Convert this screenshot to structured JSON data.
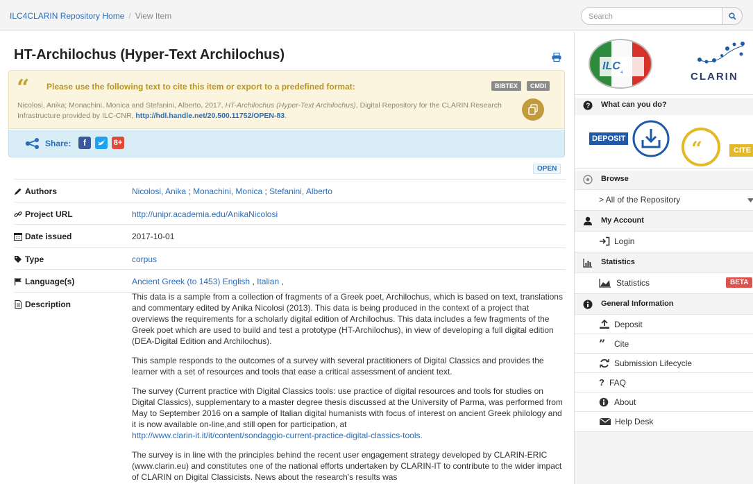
{
  "breadcrumb": {
    "home": "ILC4CLARIN Repository Home",
    "separator": "/",
    "current": "View Item"
  },
  "search": {
    "placeholder": "Search"
  },
  "item": {
    "title": "HT-Archilochus (Hyper-Text Archilochus)",
    "cite_prompt": "Please use the following text to cite this item or export to a predefined format:",
    "export_buttons": [
      "BIBTEX",
      "CMDI"
    ],
    "citation_pre": "Nicolosi, Anika; Monachini, Monica and Stefanini, Alberto, 2017, ",
    "citation_title": "HT-Archilochus (Hyper-Text Archilochus)",
    "citation_post": ", Digital Repository for the CLARIN Research Infrastructure provided by ILC-CNR, ",
    "citation_link": "http://hdl.handle.net/20.500.11752/OPEN-83",
    "citation_end": ".",
    "share_label": "Share:",
    "license_badge": "OPEN"
  },
  "metadata": {
    "authors_label": "Authors",
    "authors": [
      "Nicolosi, Anika",
      "Monachini, Monica",
      "Stefanini, Alberto"
    ],
    "project_url_label": "Project URL",
    "project_url": "http://unipr.academia.edu/AnikaNicolosi",
    "date_label": "Date issued",
    "date": "2017-10-01",
    "type_label": "Type",
    "type": "corpus",
    "language_label": "Language(s)",
    "languages": [
      "Ancient Greek (to 1453)",
      "English",
      "Italian"
    ],
    "description_label": "Description",
    "description": [
      "This data is a sample from a collection of fragments of a Greek poet, Archilochus, which is based on text, translations and commentary edited by Anika Nicolosi (2013). This data is being produced in the context of a project that overviews the requirements for a scholarly digital edition of Archilochus. This data includes a few fragments of the Greek poet which are used to build and test a prototype (HT-Archilochus), in view of developing a full digital edition (DEA-Digital Edition and Archilochus).",
      "This sample responds to the outcomes of a survey with several practitioners of Digital Classics and provides the learner with a set of resources and tools that ease a critical assessment of ancient text.",
      "The survey (Current practice with Digital Classics tools: use practice of digital resources and tools for studies on Digital Classics), supplementary to a master degree thesis discussed at the University of Parma, was performed from May to September 2016 on a sample of Italian digital humanists with focus of interest on ancient Greek philology and it is now available on-line,and still open for participation, at",
      "The survey is in line with the principles behind the recent user engagement strategy developed by CLARIN-ERIC (www.clarin.eu) and constitutes one of the national efforts undertaken by CLARIN-IT to contribute to the wider impact of CLARIN on Digital Classicists. News about the research's results was"
    ],
    "survey_link": "http://www.clarin-it.it/it/content/sondaggio-current-practice-digital-classics-tools."
  },
  "sidebar": {
    "logo_text": "CLARIN",
    "what_can_you_do": "What can you do?",
    "deposit_label": "DEPOSIT",
    "cite_label": "CITE",
    "browse": "Browse",
    "all_repository": "> All of the Repository",
    "my_account": "My Account",
    "login": "Login",
    "statistics_head": "Statistics",
    "statistics": "Statistics",
    "beta": "BETA",
    "general_info": "General Information",
    "deposit": "Deposit",
    "cite": "Cite",
    "submission_lifecycle": "Submission Lifecycle",
    "faq": "FAQ",
    "about": "About",
    "help_desk": "Help Desk"
  },
  "colors": {
    "link": "#2a6ebb",
    "cite_bg": "#fbf4df",
    "share_bg": "#d9edf7",
    "beta": "#d9534f"
  }
}
